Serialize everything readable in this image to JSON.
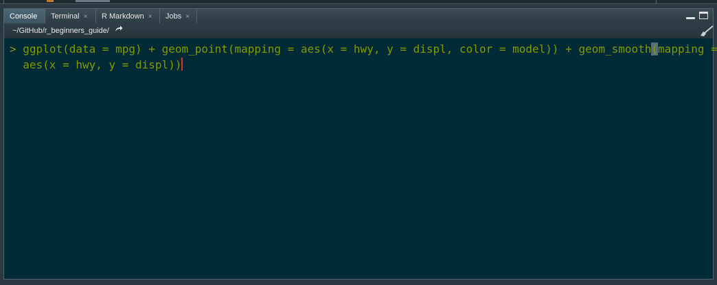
{
  "tabs": [
    {
      "label": "Console",
      "closable": false,
      "active": true
    },
    {
      "label": "Terminal",
      "closable": true,
      "active": false
    },
    {
      "label": "R Markdown",
      "closable": true,
      "active": false
    },
    {
      "label": "Jobs",
      "closable": true,
      "active": false
    }
  ],
  "close_glyph": "×",
  "path": {
    "text": "~/GitHub/r_beginners_guide/",
    "goto_icon": "arrow-right-icon"
  },
  "console": {
    "prompt": ">",
    "line1_before_paren": "ggplot(data = mpg) + geom_point(mapping = aes(x = hwy, y = displ, color = model)) + geom_smooth",
    "line1_paren": "(",
    "line1_after_paren": "mapping =",
    "line2": "aes(x = hwy, y = displ))"
  },
  "colors": {
    "console_bg": "#002b36",
    "code_text": "#859900",
    "cursor": "#dc322f"
  }
}
